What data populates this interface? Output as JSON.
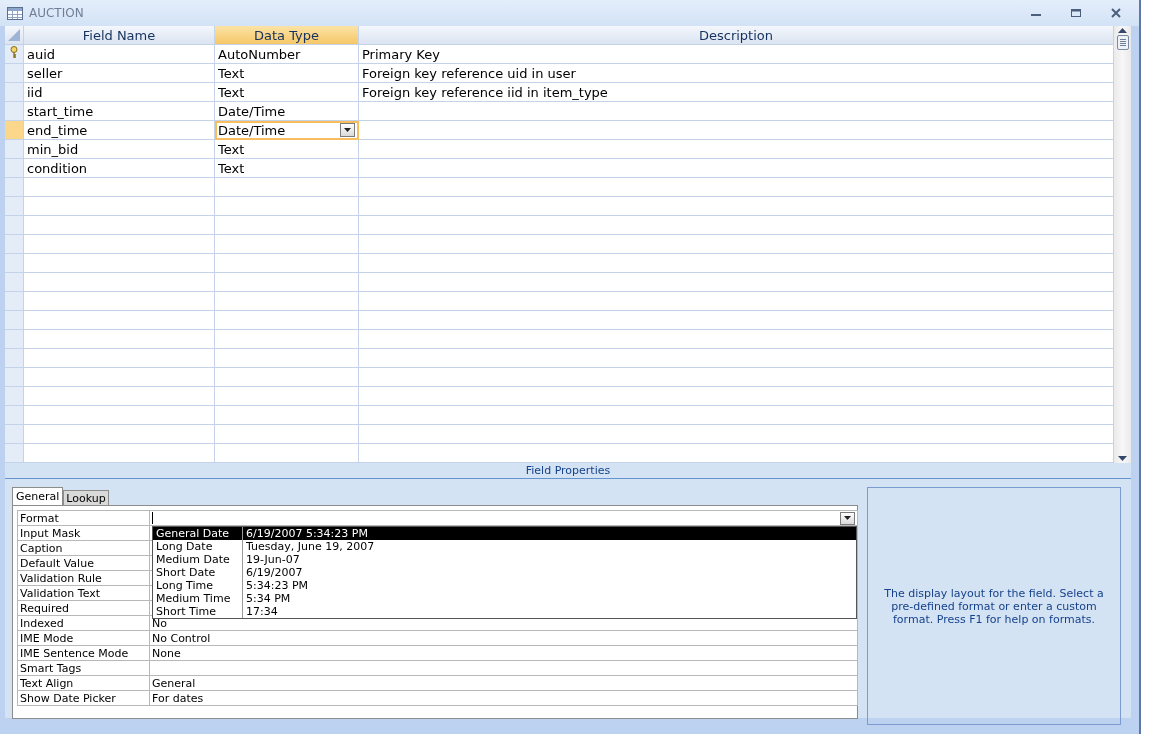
{
  "window": {
    "title": "AUCTION"
  },
  "grid": {
    "columns": [
      {
        "label": "Field Name",
        "selected": false
      },
      {
        "label": "Data Type",
        "selected": true
      },
      {
        "label": "Description",
        "selected": false
      }
    ],
    "rows": [
      {
        "field": "auid",
        "type": "AutoNumber",
        "description": "Primary Key",
        "primary_key": true,
        "selected": false
      },
      {
        "field": "seller",
        "type": "Text",
        "description": "Foreign key reference uid in user",
        "primary_key": false,
        "selected": false
      },
      {
        "field": "iid",
        "type": "Text",
        "description": "Foreign key reference iid in item_type",
        "primary_key": false,
        "selected": false
      },
      {
        "field": "start_time",
        "type": "Date/Time",
        "primary_key": false,
        "selected": false
      },
      {
        "field": "end_time",
        "type": "Date/Time",
        "primary_key": false,
        "selected": true
      },
      {
        "field": "min_bid",
        "type": "Text",
        "primary_key": false,
        "selected": false
      },
      {
        "field": "condition",
        "type": "Text",
        "primary_key": false,
        "selected": false
      }
    ]
  },
  "field_properties": {
    "title": "Field Properties",
    "tabs": [
      {
        "label": "General",
        "selected": true
      },
      {
        "label": "Lookup",
        "selected": false
      }
    ],
    "properties": [
      {
        "label": "Format",
        "kind": "dropdown"
      },
      {
        "label": "Input Mask",
        "kind": "text"
      },
      {
        "label": "Caption",
        "kind": "text"
      },
      {
        "label": "Default Value",
        "kind": "text"
      },
      {
        "label": "Validation Rule",
        "kind": "text"
      },
      {
        "label": "Validation Text",
        "kind": "text"
      },
      {
        "label": "Required",
        "kind": "text"
      },
      {
        "label": "Indexed",
        "value": "No",
        "kind": "text"
      },
      {
        "label": "IME Mode",
        "value": "No Control",
        "kind": "text"
      },
      {
        "label": "IME Sentence Mode",
        "value": "None",
        "kind": "text"
      },
      {
        "label": "Smart Tags",
        "kind": "text"
      },
      {
        "label": "Text Align",
        "value": "General",
        "kind": "text"
      },
      {
        "label": "Show Date Picker",
        "value": "For dates",
        "kind": "text"
      }
    ],
    "format_options": [
      {
        "name": "General Date",
        "example": "6/19/2007 5:34:23 PM",
        "selected": true
      },
      {
        "name": "Long Date",
        "example": "Tuesday, June 19, 2007",
        "selected": false
      },
      {
        "name": "Medium Date",
        "example": "19-Jun-07",
        "selected": false
      },
      {
        "name": "Short Date",
        "example": "6/19/2007",
        "selected": false
      },
      {
        "name": "Long Time",
        "example": "5:34:23 PM",
        "selected": false
      },
      {
        "name": "Medium Time",
        "example": "5:34 PM",
        "selected": false
      },
      {
        "name": "Short Time",
        "example": "17:34",
        "selected": false
      }
    ],
    "help": "The display layout for the field.  Select a pre-defined format or enter a custom format.  Press F1 for help on formats."
  }
}
